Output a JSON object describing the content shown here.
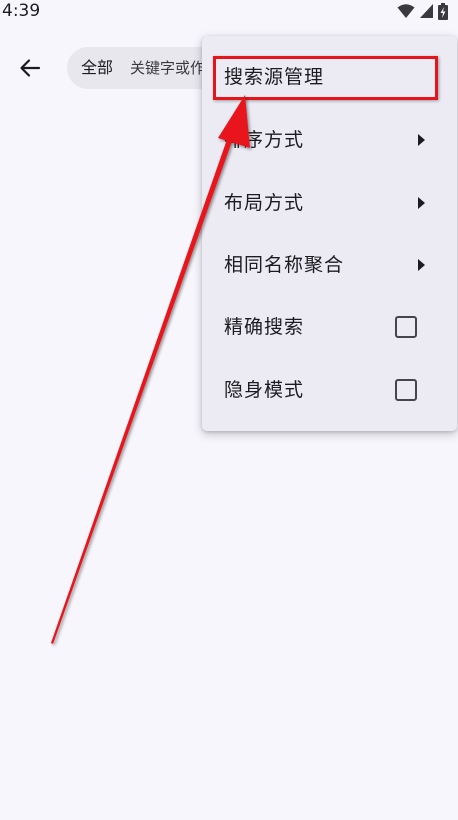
{
  "status_bar": {
    "time": "4:39",
    "icons": [
      "wifi-icon",
      "cellular-signal-icon",
      "battery-charging-icon"
    ]
  },
  "toolbar": {
    "back_icon": "arrow-left-icon",
    "search_scope": "全部",
    "search_placeholder": "关键字或作者"
  },
  "menu": {
    "items": [
      {
        "label": "搜索源管理",
        "control": "none"
      },
      {
        "label": "排序方式",
        "control": "submenu-arrow"
      },
      {
        "label": "布局方式",
        "control": "submenu-arrow"
      },
      {
        "label": "相同名称聚合",
        "control": "submenu-arrow"
      },
      {
        "label": "精确搜索",
        "control": "checkbox",
        "checked": false
      },
      {
        "label": "隐身模式",
        "control": "checkbox",
        "checked": false
      }
    ]
  },
  "annotation": {
    "highlight_color": "#e8141c",
    "points_to": "搜索源管理"
  },
  "colors": {
    "background": "#f7f6fc",
    "menu_background": "#ecebf4",
    "search_background": "#e8e7ee"
  }
}
